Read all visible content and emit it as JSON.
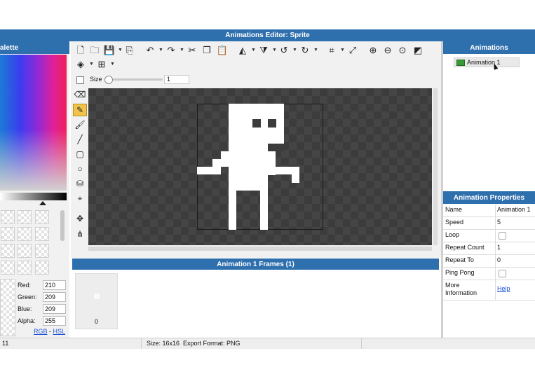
{
  "window": {
    "title": "Animations Editor: Sprite"
  },
  "palette": {
    "title": "alette",
    "red_label": "Red:",
    "red": "210",
    "green_label": "Green:",
    "green": "209",
    "blue_label": "Blue:",
    "blue": "209",
    "alpha_label": "Alpha:",
    "alpha": "255",
    "rgb_link": "RGB",
    "dash": "-",
    "hsl_link": "HSL"
  },
  "toolbar": {
    "size_label": "Size",
    "size_value": "1",
    "icons": [
      "new-file-icon",
      "open-folder-icon",
      "save-icon",
      "export-icon",
      "undo-icon",
      "redo-icon",
      "cut-icon",
      "copy-icon",
      "paste-icon",
      "flip-horizontal-icon",
      "flip-vertical-icon",
      "rotate-left-icon",
      "rotate-right-icon",
      "crop-icon",
      "resize-icon",
      "zoom-in-icon",
      "zoom-out-icon",
      "zoom-reset-icon",
      "grid-toggle-icon",
      "layers-icon",
      "grid-icon"
    ]
  },
  "tools": [
    "eraser-tool",
    "pencil-tool",
    "brush-tool",
    "line-tool",
    "rectangle-tool",
    "ellipse-tool",
    "fill-bucket-tool",
    "eyedropper-tool",
    "move-tool",
    "skeleton-tool"
  ],
  "active_tool": "pencil-tool",
  "frames_panel": {
    "title": "Animation 1 Frames (1)",
    "frames": [
      {
        "index": "0"
      }
    ]
  },
  "animations_panel": {
    "title": "Animations",
    "items": [
      {
        "label": "Animation 1"
      }
    ]
  },
  "properties_panel": {
    "title": "Animation Properties",
    "name_label": "Name",
    "name_value": "Animation 1",
    "speed_label": "Speed",
    "speed_value": "5",
    "loop_label": "Loop",
    "loop_checked": false,
    "repeat_count_label": "Repeat Count",
    "repeat_count_value": "1",
    "repeat_to_label": "Repeat To",
    "repeat_to_value": "0",
    "ping_pong_label": "Ping Pong",
    "ping_pong_checked": false,
    "more_info_label_1": "More",
    "more_info_label_2": "Information",
    "help_link": "Help"
  },
  "status_bar": {
    "left": "11",
    "center": "Size: 16x16  Export Format: PNG"
  },
  "colors": {
    "title_bar": "#2e6fad",
    "canvas_bg": "#3c3c3c",
    "sprite": "#ffffff",
    "active_tool": "#f0c34a",
    "link": "#1a4fd6"
  }
}
